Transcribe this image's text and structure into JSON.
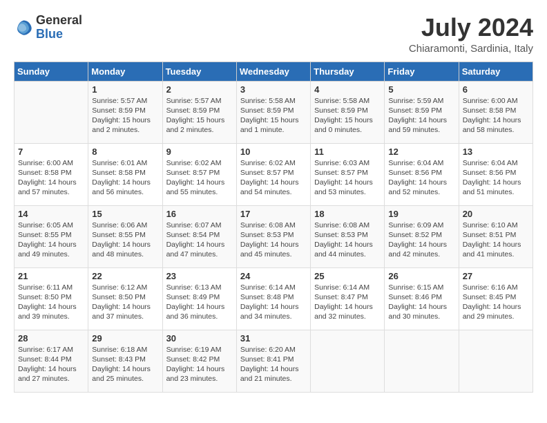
{
  "logo": {
    "text_general": "General",
    "text_blue": "Blue"
  },
  "title": {
    "month_year": "July 2024",
    "location": "Chiaramonti, Sardinia, Italy"
  },
  "days_of_week": [
    "Sunday",
    "Monday",
    "Tuesday",
    "Wednesday",
    "Thursday",
    "Friday",
    "Saturday"
  ],
  "weeks": [
    [
      {
        "day": null,
        "content": ""
      },
      {
        "day": "1",
        "content": "Sunrise: 5:57 AM\nSunset: 8:59 PM\nDaylight: 15 hours\nand 2 minutes."
      },
      {
        "day": "2",
        "content": "Sunrise: 5:57 AM\nSunset: 8:59 PM\nDaylight: 15 hours\nand 2 minutes."
      },
      {
        "day": "3",
        "content": "Sunrise: 5:58 AM\nSunset: 8:59 PM\nDaylight: 15 hours\nand 1 minute."
      },
      {
        "day": "4",
        "content": "Sunrise: 5:58 AM\nSunset: 8:59 PM\nDaylight: 15 hours\nand 0 minutes."
      },
      {
        "day": "5",
        "content": "Sunrise: 5:59 AM\nSunset: 8:59 PM\nDaylight: 14 hours\nand 59 minutes."
      },
      {
        "day": "6",
        "content": "Sunrise: 6:00 AM\nSunset: 8:58 PM\nDaylight: 14 hours\nand 58 minutes."
      }
    ],
    [
      {
        "day": "7",
        "content": "Sunrise: 6:00 AM\nSunset: 8:58 PM\nDaylight: 14 hours\nand 57 minutes."
      },
      {
        "day": "8",
        "content": "Sunrise: 6:01 AM\nSunset: 8:58 PM\nDaylight: 14 hours\nand 56 minutes."
      },
      {
        "day": "9",
        "content": "Sunrise: 6:02 AM\nSunset: 8:57 PM\nDaylight: 14 hours\nand 55 minutes."
      },
      {
        "day": "10",
        "content": "Sunrise: 6:02 AM\nSunset: 8:57 PM\nDaylight: 14 hours\nand 54 minutes."
      },
      {
        "day": "11",
        "content": "Sunrise: 6:03 AM\nSunset: 8:57 PM\nDaylight: 14 hours\nand 53 minutes."
      },
      {
        "day": "12",
        "content": "Sunrise: 6:04 AM\nSunset: 8:56 PM\nDaylight: 14 hours\nand 52 minutes."
      },
      {
        "day": "13",
        "content": "Sunrise: 6:04 AM\nSunset: 8:56 PM\nDaylight: 14 hours\nand 51 minutes."
      }
    ],
    [
      {
        "day": "14",
        "content": "Sunrise: 6:05 AM\nSunset: 8:55 PM\nDaylight: 14 hours\nand 49 minutes."
      },
      {
        "day": "15",
        "content": "Sunrise: 6:06 AM\nSunset: 8:55 PM\nDaylight: 14 hours\nand 48 minutes."
      },
      {
        "day": "16",
        "content": "Sunrise: 6:07 AM\nSunset: 8:54 PM\nDaylight: 14 hours\nand 47 minutes."
      },
      {
        "day": "17",
        "content": "Sunrise: 6:08 AM\nSunset: 8:53 PM\nDaylight: 14 hours\nand 45 minutes."
      },
      {
        "day": "18",
        "content": "Sunrise: 6:08 AM\nSunset: 8:53 PM\nDaylight: 14 hours\nand 44 minutes."
      },
      {
        "day": "19",
        "content": "Sunrise: 6:09 AM\nSunset: 8:52 PM\nDaylight: 14 hours\nand 42 minutes."
      },
      {
        "day": "20",
        "content": "Sunrise: 6:10 AM\nSunset: 8:51 PM\nDaylight: 14 hours\nand 41 minutes."
      }
    ],
    [
      {
        "day": "21",
        "content": "Sunrise: 6:11 AM\nSunset: 8:50 PM\nDaylight: 14 hours\nand 39 minutes."
      },
      {
        "day": "22",
        "content": "Sunrise: 6:12 AM\nSunset: 8:50 PM\nDaylight: 14 hours\nand 37 minutes."
      },
      {
        "day": "23",
        "content": "Sunrise: 6:13 AM\nSunset: 8:49 PM\nDaylight: 14 hours\nand 36 minutes."
      },
      {
        "day": "24",
        "content": "Sunrise: 6:14 AM\nSunset: 8:48 PM\nDaylight: 14 hours\nand 34 minutes."
      },
      {
        "day": "25",
        "content": "Sunrise: 6:14 AM\nSunset: 8:47 PM\nDaylight: 14 hours\nand 32 minutes."
      },
      {
        "day": "26",
        "content": "Sunrise: 6:15 AM\nSunset: 8:46 PM\nDaylight: 14 hours\nand 30 minutes."
      },
      {
        "day": "27",
        "content": "Sunrise: 6:16 AM\nSunset: 8:45 PM\nDaylight: 14 hours\nand 29 minutes."
      }
    ],
    [
      {
        "day": "28",
        "content": "Sunrise: 6:17 AM\nSunset: 8:44 PM\nDaylight: 14 hours\nand 27 minutes."
      },
      {
        "day": "29",
        "content": "Sunrise: 6:18 AM\nSunset: 8:43 PM\nDaylight: 14 hours\nand 25 minutes."
      },
      {
        "day": "30",
        "content": "Sunrise: 6:19 AM\nSunset: 8:42 PM\nDaylight: 14 hours\nand 23 minutes."
      },
      {
        "day": "31",
        "content": "Sunrise: 6:20 AM\nSunset: 8:41 PM\nDaylight: 14 hours\nand 21 minutes."
      },
      {
        "day": null,
        "content": ""
      },
      {
        "day": null,
        "content": ""
      },
      {
        "day": null,
        "content": ""
      }
    ]
  ]
}
